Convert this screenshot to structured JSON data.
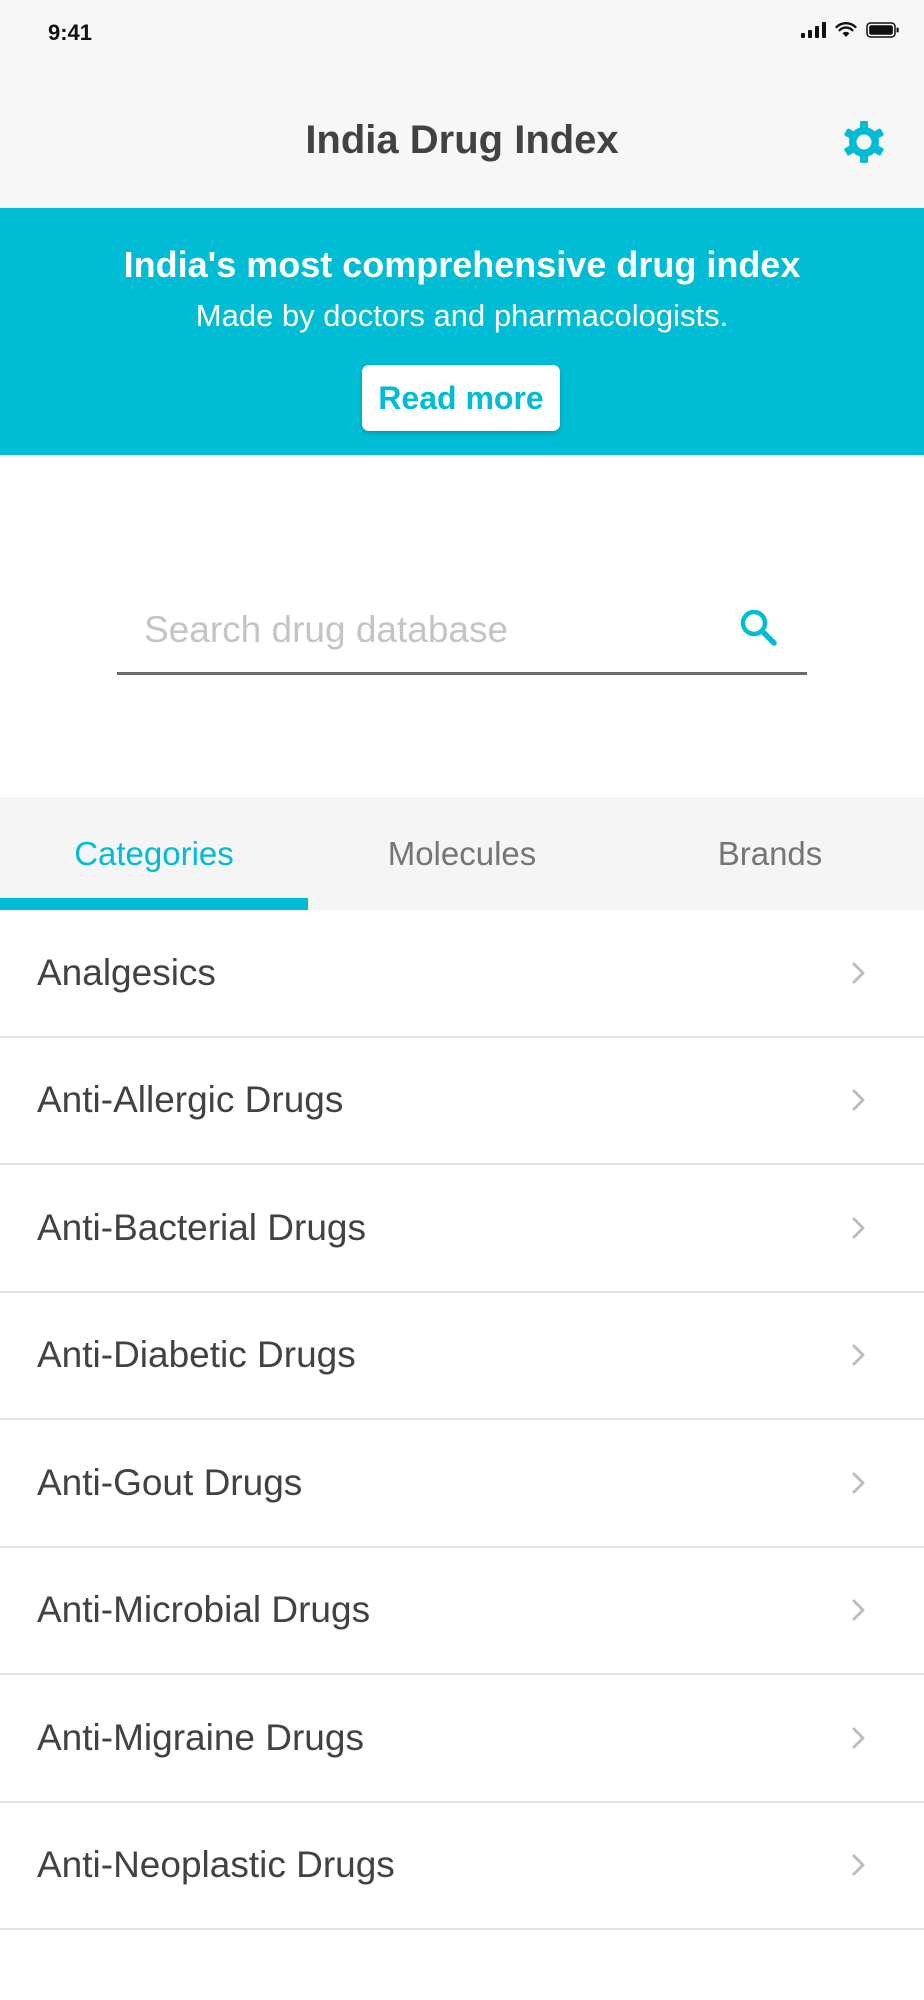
{
  "status_bar": {
    "time": "9:41"
  },
  "header": {
    "title": "India Drug Index"
  },
  "banner": {
    "title": "India's most comprehensive drug index",
    "subtitle": "Made by doctors and pharmacologists.",
    "button_label": "Read more"
  },
  "search": {
    "placeholder": "Search drug database",
    "value": ""
  },
  "tabs": [
    {
      "label": "Categories",
      "active": true
    },
    {
      "label": "Molecules",
      "active": false
    },
    {
      "label": "Brands",
      "active": false
    }
  ],
  "categories": [
    {
      "label": "Analgesics"
    },
    {
      "label": "Anti-Allergic Drugs"
    },
    {
      "label": "Anti-Bacterial Drugs"
    },
    {
      "label": "Anti-Diabetic Drugs"
    },
    {
      "label": "Anti-Gout Drugs"
    },
    {
      "label": "Anti-Microbial Drugs"
    },
    {
      "label": "Anti-Migraine Drugs"
    },
    {
      "label": "Anti-Neoplastic Drugs"
    }
  ],
  "colors": {
    "accent": "#00bcd4",
    "header_bg": "#f7f7f7",
    "text": "#424242",
    "tab_inactive": "#757575",
    "divider": "#e3e3e3"
  },
  "icons": {
    "settings": "gear-icon",
    "search": "search-icon",
    "row": "chevron-right-icon"
  }
}
